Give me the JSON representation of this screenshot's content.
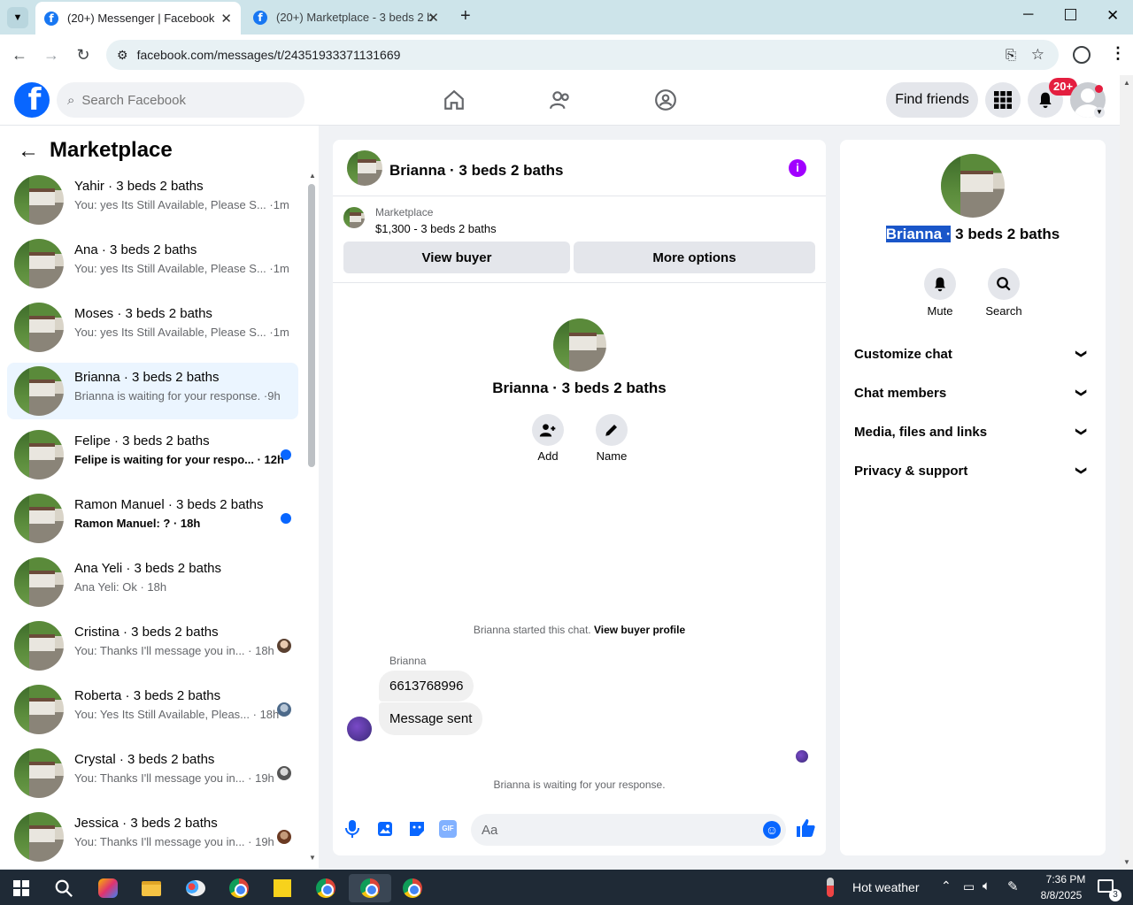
{
  "browser": {
    "tabs": [
      {
        "title": "(20+) Messenger | Facebook",
        "active": true
      },
      {
        "title": "(20+) Marketplace - 3 beds 2 b",
        "active": false
      }
    ],
    "url": "facebook.com/messages/t/24351933371131669"
  },
  "header": {
    "search_placeholder": "Search Facebook",
    "find_friends": "Find friends",
    "notif_badge": "20+"
  },
  "sidebar": {
    "title": "Marketplace",
    "conversations": [
      {
        "name": "Yahir · 3 beds 2 baths",
        "preview": "You: yes Its Still Available, Please S... ·1m",
        "unread": false,
        "selected": false
      },
      {
        "name": "Ana · 3 beds 2 baths",
        "preview": "You: yes Its Still Available, Please S... ·1m",
        "unread": false,
        "selected": false
      },
      {
        "name": "Moses · 3 beds 2 baths",
        "preview": "You: yes Its Still Available, Please S... ·1m",
        "unread": false,
        "selected": false
      },
      {
        "name": "Brianna · 3 beds 2 baths",
        "preview": "Brianna is waiting for your response. ·9h",
        "unread": false,
        "selected": true
      },
      {
        "name": "Felipe · 3 beds 2 baths",
        "preview": "Felipe is waiting for your respo... · 12h",
        "unread": true,
        "selected": false
      },
      {
        "name": "Ramon Manuel · 3 beds 2 baths",
        "preview": "Ramon Manuel: ? · 18h",
        "unread": true,
        "selected": false
      },
      {
        "name": "Ana Yeli · 3 beds 2 baths",
        "preview": "Ana Yeli: Ok · 18h",
        "unread": false,
        "selected": false
      },
      {
        "name": "Cristina · 3 beds 2 baths",
        "preview": "You: Thanks I'll message you in... · 18h",
        "unread": false,
        "selected": false
      },
      {
        "name": "Roberta · 3 beds 2 baths",
        "preview": "You: Yes Its Still Available, Pleas... · 18h",
        "unread": false,
        "selected": false
      },
      {
        "name": "Crystal · 3 beds 2 baths",
        "preview": "You: Thanks I'll message you in... · 19h",
        "unread": false,
        "selected": false
      },
      {
        "name": "Jessica · 3 beds 2 baths",
        "preview": "You: Thanks I'll message you in... · 19h",
        "unread": false,
        "selected": false
      }
    ]
  },
  "chat": {
    "title": "Brianna · 3 beds 2 baths",
    "listing_source": "Marketplace",
    "listing_title": "$1,300 - 3 beds 2 baths",
    "view_buyer": "View buyer",
    "more_options": "More options",
    "profile_name": "Brianna · 3 beds 2 baths",
    "add_label": "Add",
    "name_label": "Name",
    "started_text": "Brianna started this chat.",
    "view_buyer_profile": "View buyer profile",
    "sender": "Brianna",
    "messages": [
      "6613768996",
      "Message sent"
    ],
    "waiting_text": "Brianna is waiting for your response.",
    "input_placeholder": "Aa"
  },
  "info": {
    "name_first": "Brianna ·",
    "name_rest": " 3 beds 2 baths",
    "mute": "Mute",
    "search": "Search",
    "sections": [
      "Customize chat",
      "Chat members",
      "Media, files and links",
      "Privacy & support"
    ]
  },
  "taskbar": {
    "weather": "Hot weather",
    "time": "7:36 PM",
    "date": "8/8/2025",
    "notif_count": "3"
  },
  "colors": {
    "brand": "#1877f2",
    "unread_dot": "#0866ff",
    "info_icon": "#a100ff",
    "selection": "#ebf5ff"
  }
}
